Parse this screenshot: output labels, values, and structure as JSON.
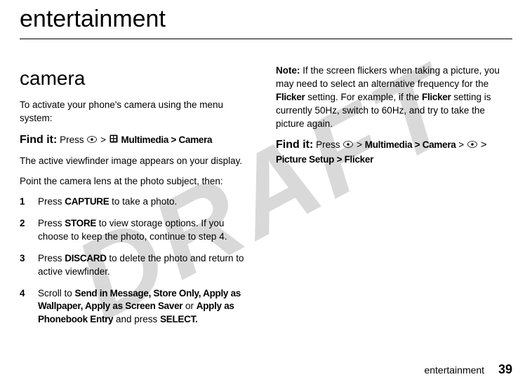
{
  "watermark": "DRAFT",
  "main_title": "entertainment",
  "left": {
    "section_title": "camera",
    "intro": "To activate your phone's camera using the menu system:",
    "findit_label": "Find it:",
    "findit_press": "Press",
    "findit_path": "Multimedia > Camera",
    "gt": ">",
    "after_findit": "The active viewfinder image appears on your display.",
    "point_text": "Point the camera lens at the photo subject, then:",
    "steps": [
      {
        "n": "1",
        "pre": "Press ",
        "key": "CAPTURE",
        "post": " to take a photo."
      },
      {
        "n": "2",
        "pre": "Press ",
        "key": "STORE",
        "post": " to view storage options. If you choose to keep the photo, continue to step 4."
      },
      {
        "n": "3",
        "pre": "Press ",
        "key": "DISCARD",
        "post": " to delete the photo and return to active viewfinder."
      },
      {
        "n": "4",
        "pre": "Scroll to ",
        "opts": "Send in Message,  Store Only,  Apply as Wallpaper,  Apply as Screen Saver",
        "mid": " or ",
        "opt2": "Apply as Phonebook Entry",
        "post2": " and press ",
        "key2": "SELECT."
      }
    ]
  },
  "right": {
    "note_label": "Note:",
    "note_pre": " If the screen flickers when taking a picture, you may need to select an alternative frequency for the ",
    "flicker1": "Flicker",
    "note_mid": " setting. For example, if the ",
    "flicker2": "Flicker",
    "note_post": " setting is currently 50Hz, switch to 60Hz, and try to take the picture again.",
    "findit_label": "Find it:",
    "findit_press": "Press",
    "path1": "Multimedia > Camera",
    "path2": "Picture Setup > Flicker",
    "gt": ">"
  },
  "footer": {
    "section": "entertainment",
    "page": "39"
  }
}
